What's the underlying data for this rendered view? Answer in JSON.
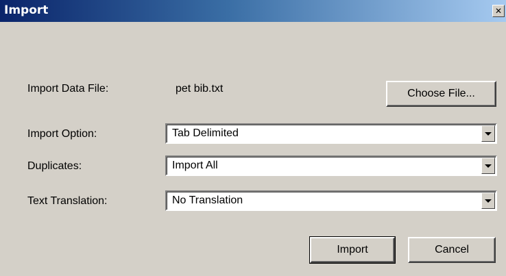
{
  "window": {
    "title": "Import",
    "close_icon": "close-icon",
    "close_glyph": "✕"
  },
  "file": {
    "label": "Import Data File:",
    "value": "pet bib.txt",
    "choose_label": "Choose File..."
  },
  "import_option": {
    "label": "Import Option:",
    "value": "Tab Delimited"
  },
  "duplicates": {
    "label": "Duplicates:",
    "value": "Import All"
  },
  "text_translation": {
    "label": "Text Translation:",
    "value": "No Translation"
  },
  "actions": {
    "import_label": "Import",
    "cancel_label": "Cancel"
  },
  "colors": {
    "title_start": "#0a246a",
    "title_end": "#a6caf0",
    "face": "#d4d0c8"
  }
}
